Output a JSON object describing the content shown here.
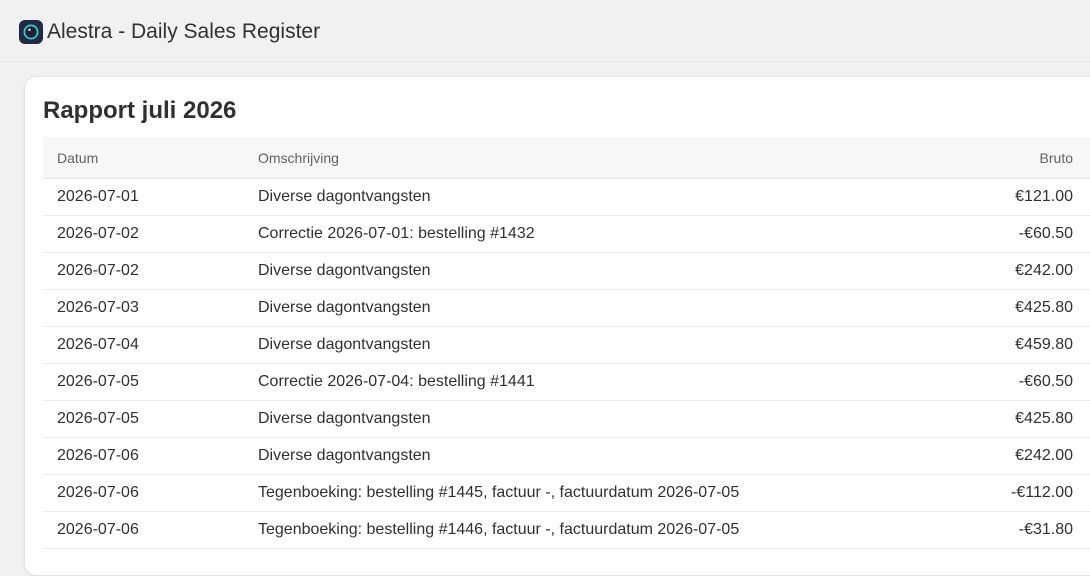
{
  "app": {
    "title": "Alestra - Daily Sales Register",
    "icon": "app-logo-icon",
    "accent": "#1f2a44"
  },
  "report": {
    "title": "Rapport juli 2026",
    "columns": {
      "date": "Datum",
      "description": "Omschrijving",
      "gross": "Bruto"
    },
    "rows": [
      {
        "date": "2026-07-01",
        "description": "Diverse dagontvangsten",
        "gross": "€121.00"
      },
      {
        "date": "2026-07-02",
        "description": "Correctie 2026-07-01: bestelling #1432",
        "gross": "-€60.50"
      },
      {
        "date": "2026-07-02",
        "description": "Diverse dagontvangsten",
        "gross": "€242.00"
      },
      {
        "date": "2026-07-03",
        "description": "Diverse dagontvangsten",
        "gross": "€425.80"
      },
      {
        "date": "2026-07-04",
        "description": "Diverse dagontvangsten",
        "gross": "€459.80"
      },
      {
        "date": "2026-07-05",
        "description": "Correctie 2026-07-04: bestelling #1441",
        "gross": "-€60.50"
      },
      {
        "date": "2026-07-05",
        "description": "Diverse dagontvangsten",
        "gross": "€425.80"
      },
      {
        "date": "2026-07-06",
        "description": "Diverse dagontvangsten",
        "gross": "€242.00"
      },
      {
        "date": "2026-07-06",
        "description": "Tegenboeking: bestelling #1445, factuur -, factuurdatum 2026-07-05",
        "gross": "-€112.00"
      },
      {
        "date": "2026-07-06",
        "description": "Tegenboeking: bestelling #1446, factuur -, factuurdatum 2026-07-05",
        "gross": "-€31.80"
      }
    ]
  }
}
